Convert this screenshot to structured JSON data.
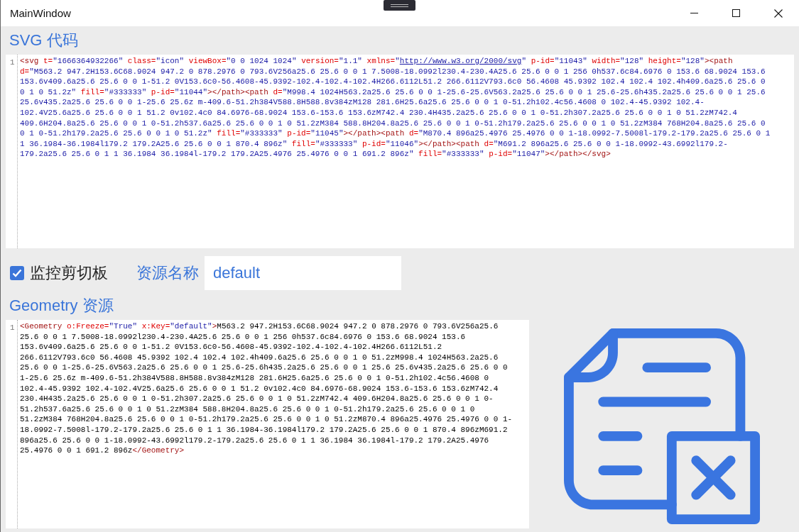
{
  "window": {
    "title": "MainWindow"
  },
  "svg_section": {
    "heading": "SVG 代码",
    "editor": {
      "line_number": "1",
      "tokens": [
        {
          "kind": "tag",
          "text": "<svg"
        },
        {
          "kind": "attr",
          "text": " t="
        },
        {
          "kind": "value",
          "text": "\"1666364932266\""
        },
        {
          "kind": "attr",
          "text": " class="
        },
        {
          "kind": "value",
          "text": "\"icon\""
        },
        {
          "kind": "attr",
          "text": " viewBox="
        },
        {
          "kind": "value",
          "text": "\"0 0 1024 1024\""
        },
        {
          "kind": "attr",
          "text": " version="
        },
        {
          "kind": "value",
          "text": "\"1.1\""
        },
        {
          "kind": "attr",
          "text": " xmlns="
        },
        {
          "kind": "value",
          "text": "\""
        },
        {
          "kind": "link",
          "text": "http://www.w3.org/2000/svg"
        },
        {
          "kind": "value",
          "text": "\""
        },
        {
          "kind": "attr",
          "text": " p-id="
        },
        {
          "kind": "value",
          "text": "\"11043\""
        },
        {
          "kind": "attr",
          "text": " width="
        },
        {
          "kind": "value",
          "text": "\"128\""
        },
        {
          "kind": "attr",
          "text": " height="
        },
        {
          "kind": "value",
          "text": "\"128\""
        },
        {
          "kind": "tag",
          "text": "><path"
        },
        {
          "kind": "attr",
          "text": " d="
        },
        {
          "kind": "value",
          "text": "\"M563.2 947.2H153.6C68.9024 947.2 0 878.2976 0 793.6V256a25.6 25.6 0 0 1 7.5008-18.0992l230.4-230.4A25.6 25.6 0 0 1 256 0h537.6c84.6976 0 153.6 68.9024 153.6 153.6v409.6a25.6 25.6 0 0 1-51.2 0V153.6c0-56.4608-45.9392-102.4-102.4-102.4H266.6112L51.2 266.6112V793.6c0 56.4608 45.9392 102.4 102.4 102.4h409.6a25.6 25.6 0 0 1 0 51.2z\""
        },
        {
          "kind": "attr",
          "text": " fill="
        },
        {
          "kind": "value",
          "text": "\"#333333\""
        },
        {
          "kind": "attr",
          "text": " p-id="
        },
        {
          "kind": "value",
          "text": "\"11044\""
        },
        {
          "kind": "tag",
          "text": "></path><path"
        },
        {
          "kind": "attr",
          "text": " d="
        },
        {
          "kind": "value",
          "text": "\"M998.4 1024H563.2a25.6 25.6 0 0 1-25.6-25.6V563.2a25.6 25.6 0 0 1 25.6-25.6h435.2a25.6 25.6 0 0 1 25.6 25.6v435.2a25.6 25.6 0 0 1-25.6 25.6z m-409.6-51.2h384V588.8H588.8v384zM128 281.6H25.6a25.6 25.6 0 0 1 0-51.2h102.4c56.4608 0 102.4-45.9392 102.4-102.4V25.6a25.6 25.6 0 0 1 51.2 0v102.4c0 84.6976-68.9024 153.6-153.6 153.6zM742.4 230.4H435.2a25.6 25.6 0 0 1 0-51.2h307.2a25.6 25.6 0 0 1 0 51.2zM742.4 409.6H204.8a25.6 25.6 0 0 1 0-51.2h537.6a25.6 25.6 0 0 1 0 51.2zM384 588.8H204.8a25.6 25.6 0 0 1 0-51.2h179.2a25.6 25.6 0 0 1 0 51.2zM384 768H204.8a25.6 25.6 0 0 1 0-51.2h179.2a25.6 25.6 0 0 1 0 51.2z\""
        },
        {
          "kind": "attr",
          "text": " fill="
        },
        {
          "kind": "value",
          "text": "\"#333333\""
        },
        {
          "kind": "attr",
          "text": " p-id="
        },
        {
          "kind": "value",
          "text": "\"11045\""
        },
        {
          "kind": "tag",
          "text": "></path><path"
        },
        {
          "kind": "attr",
          "text": " d="
        },
        {
          "kind": "value",
          "text": "\"M870.4 896a25.4976 25.4976 0 0 1-18.0992-7.5008l-179.2-179.2a25.6 25.6 0 1 1 36.1984-36.1984l179.2 179.2A25.6 25.6 0 0 1 870.4 896z\""
        },
        {
          "kind": "attr",
          "text": " fill="
        },
        {
          "kind": "value",
          "text": "\"#333333\""
        },
        {
          "kind": "attr",
          "text": " p-id="
        },
        {
          "kind": "value",
          "text": "\"11046\""
        },
        {
          "kind": "tag",
          "text": "></path><path"
        },
        {
          "kind": "attr",
          "text": " d="
        },
        {
          "kind": "value",
          "text": "\"M691.2 896a25.6 25.6 0 0 1-18.0992-43.6992l179.2-179.2a25.6 25.6 0 1 1 36.1984 36.1984l-179.2 179.2A25.4976 25.4976 0 0 1 691.2 896z\""
        },
        {
          "kind": "attr",
          "text": " fill="
        },
        {
          "kind": "value",
          "text": "\"#333333\""
        },
        {
          "kind": "attr",
          "text": " p-id="
        },
        {
          "kind": "value",
          "text": "\"11047\""
        },
        {
          "kind": "tag",
          "text": "></path></svg>"
        }
      ]
    }
  },
  "options": {
    "monitor_clipboard": {
      "label": "监控剪切板",
      "checked": true
    },
    "resource_name": {
      "label": "资源名称",
      "value": "default"
    }
  },
  "geometry_section": {
    "heading": "Geometry 资源",
    "editor": {
      "line_number": "1",
      "tokens": [
        {
          "kind": "tag",
          "text": "<Geometry"
        },
        {
          "kind": "attr",
          "text": " o:Freeze="
        },
        {
          "kind": "value",
          "text": "\"True\""
        },
        {
          "kind": "attr",
          "text": " x:Key="
        },
        {
          "kind": "value",
          "text": "\"default\""
        },
        {
          "kind": "tag",
          "text": ">"
        },
        {
          "kind": "text",
          "text": "M563.2 947.2H153.6C68.9024 947.2 0 878.2976 0 793.6V256a25.6 25.6 0 0 1 7.5008-18.0992l230.4-230.4A25.6 25.6 0 0 1 256 0h537.6c84.6976 0 153.6 68.9024 153.6 153.6v409.6a25.6 25.6 0 0 1-51.2 0V153.6c0-56.4608-45.9392-102.4-102.4-102.4H266.6112L51.2 266.6112V793.6c0 56.4608 45.9392 102.4 102.4 102.4h409.6a25.6 25.6 0 0 1 0 51.2zM998.4 1024H563.2a25.6 25.6 0 0 1-25.6-25.6V563.2a25.6 25.6 0 0 1 25.6-25.6h435.2a25.6 25.6 0 0 1 25.6 25.6v435.2a25.6 25.6 0 0 1-25.6 25.6z m-409.6-51.2h384V588.8H588.8v384zM128 281.6H25.6a25.6 25.6 0 0 1 0-51.2h102.4c56.4608 0 102.4-45.9392 102.4-102.4V25.6a25.6 25.6 0 0 1 51.2 0v102.4c0 84.6976-68.9024 153.6-153.6 153.6zM742.4 230.4H435.2a25.6 25.6 0 0 1 0-51.2h307.2a25.6 25.6 0 0 1 0 51.2zM742.4 409.6H204.8a25.6 25.6 0 0 1 0-51.2h537.6a25.6 25.6 0 0 1 0 51.2zM384 588.8H204.8a25.6 25.6 0 0 1 0-51.2h179.2a25.6 25.6 0 0 1 0 51.2zM384 768H204.8a25.6 25.6 0 0 1 0-51.2h179.2a25.6 25.6 0 0 1 0 51.2zM870.4 896a25.4976 25.4976 0 0 1-18.0992-7.5008l-179.2-179.2a25.6 25.6 0 1 1 36.1984-36.1984l179.2 179.2A25.6 25.6 0 0 1 870.4 896zM691.2 896a25.6 25.6 0 0 1-18.0992-43.6992l179.2-179.2a25.6 25.6 0 1 1 36.1984 36.1984l-179.2 179.2A25.4976 25.4976 0 0 1 691.2 896z"
        },
        {
          "kind": "tag",
          "text": "</Geometry>"
        }
      ]
    }
  }
}
